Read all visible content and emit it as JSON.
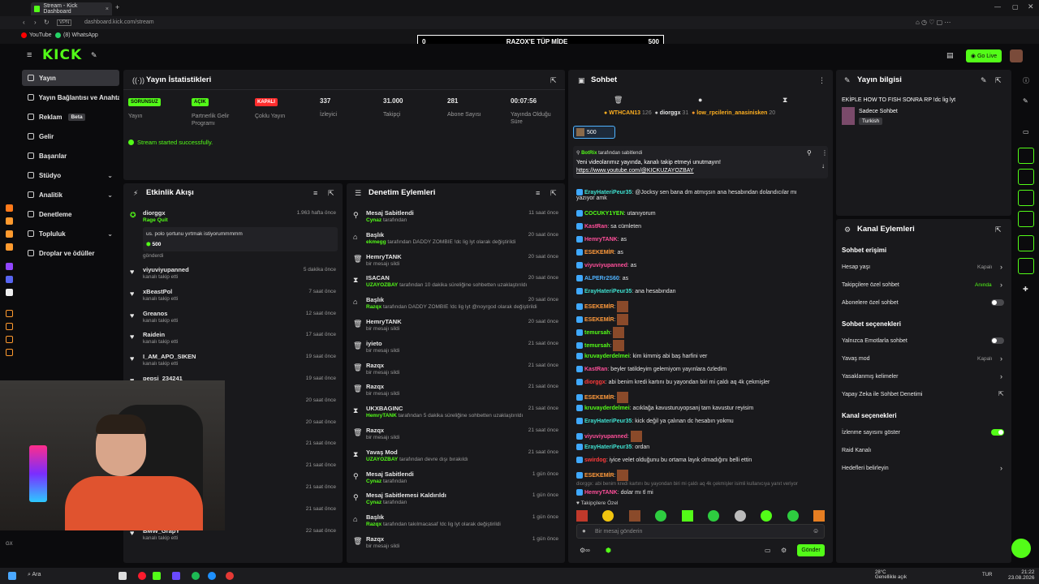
{
  "browser": {
    "tab_title": "Stream - Kick Dashboard",
    "url": "dashboard.kick.com/stream",
    "bookmarks": [
      "YouTube",
      "(8) WhatsApp"
    ]
  },
  "header": {
    "logo": "KICK",
    "goal_left": "0",
    "goal_title": "RAZQX'E TÜP MİDE",
    "goal_right": "500",
    "go_live": "Go Live"
  },
  "sidebar": {
    "items": [
      {
        "label": "Yayın"
      },
      {
        "label": "Yayın Bağlantısı ve Anahtarı"
      },
      {
        "label": "Reklam",
        "badge": "Beta"
      },
      {
        "label": "Gelir"
      },
      {
        "label": "Başarılar"
      },
      {
        "label": "Stüdyo"
      },
      {
        "label": "Analitik"
      },
      {
        "label": "Denetleme"
      },
      {
        "label": "Topluluk"
      },
      {
        "label": "Droplar ve ödüller"
      }
    ]
  },
  "stats": {
    "title": "Yayın İstatistikleri",
    "cells": [
      {
        "badge": "SORUNSUZ",
        "label": "Yayın"
      },
      {
        "badge": "AÇIK",
        "label": "Partnerlik Gelir Programı"
      },
      {
        "badge": "KAPALI",
        "label": "Çoklu Yayın"
      },
      {
        "value": "337",
        "label": "İzleyici"
      },
      {
        "value": "31.000",
        "label": "Takipçi"
      },
      {
        "value": "281",
        "label": "Abone Sayısı"
      },
      {
        "value": "00:07:56",
        "label": "Yayında Olduğu Süre"
      }
    ],
    "status_msg": "Stream started successfully."
  },
  "activity": {
    "title": "Etkinlik Akışı",
    "featured": {
      "name": "diorggx",
      "sub": "Rage Quit",
      "time": "1.963 hafta önce",
      "message": "us. polo şortunu yırtmak istiyorummmmm",
      "amount": "500",
      "footer": "gönderdi"
    },
    "items": [
      {
        "name": "viyuviyupanned",
        "sub": "kanalı takip etti",
        "time": "5 dakika önce"
      },
      {
        "name": "xBeastPol",
        "sub": "kanalı takip etti",
        "time": "7 saat önce"
      },
      {
        "name": "Greanos",
        "sub": "kanalı takip etti",
        "time": "12 saat önce"
      },
      {
        "name": "Raidein",
        "sub": "kanalı takip etti",
        "time": "17 saat önce"
      },
      {
        "name": "I_AM_APO_SIKEN",
        "sub": "kanalı takip etti",
        "time": "19 saat önce"
      },
      {
        "name": "pepsi_234241",
        "sub": "",
        "time": "19 saat önce"
      },
      {
        "name": "",
        "sub": "",
        "time": "20 saat önce"
      },
      {
        "name": "",
        "sub": "",
        "time": "20 saat önce"
      },
      {
        "name": "",
        "sub": "",
        "time": "21 saat önce"
      },
      {
        "name": "",
        "sub": "",
        "time": "21 saat önce"
      },
      {
        "name": "",
        "sub": "",
        "time": "21 saat önce"
      },
      {
        "name": "alexapp",
        "sub": "kanalı takip etti",
        "time": "21 saat önce"
      },
      {
        "name": "BMW_GrapY",
        "sub": "kanalı takip etti",
        "time": "22 saat önce"
      }
    ]
  },
  "moderation": {
    "title": "Denetim Eylemleri",
    "items": [
      {
        "name": "Mesaj Sabitlendi",
        "user": "Cynaz",
        "rest": "tarafından",
        "time": "11 saat önce"
      },
      {
        "name": "Başlık",
        "user": "ekmegg",
        "rest": "tarafından DADDY ZOMBIE !dc lig lyt olarak değiştirildi",
        "time": "20 saat önce"
      },
      {
        "name": "HemryTANK",
        "user": "",
        "rest": "bir mesajı sildi",
        "time": "20 saat önce"
      },
      {
        "name": "ISACAN",
        "user": "UZAYOZBAY",
        "rest": "tarafından 10 dakika süreliğine sohbetten uzaklaştırıldı",
        "time": "20 saat önce"
      },
      {
        "name": "Başlık",
        "user": "Razqx",
        "rest": "tarafından DADDY ZOMBIE !dc lig lyt @noyrgod olarak değiştirildi",
        "time": "20 saat önce"
      },
      {
        "name": "HemryTANK",
        "user": "",
        "rest": "bir mesajı sildi",
        "time": "20 saat önce"
      },
      {
        "name": "iyieto",
        "user": "",
        "rest": "bir mesajı sildi",
        "time": "21 saat önce"
      },
      {
        "name": "Razqx",
        "user": "",
        "rest": "bir mesajı sildi",
        "time": "21 saat önce"
      },
      {
        "name": "Razqx",
        "user": "",
        "rest": "bir mesajı sildi",
        "time": "21 saat önce"
      },
      {
        "name": "UKXBAGINC",
        "user": "HemryTANK",
        "rest": "tarafından 5 dakika süreliğine sohbetten uzaklaştırıldı",
        "time": "21 saat önce"
      },
      {
        "name": "Razqx",
        "user": "",
        "rest": "bir mesajı sildi",
        "time": "21 saat önce"
      },
      {
        "name": "Yavaş Mod",
        "user": "UZAYOZBAY",
        "rest": "tarafından devre dışı bırakıldı",
        "time": "21 saat önce"
      },
      {
        "name": "Mesaj Sabitlendi",
        "user": "Cynaz",
        "rest": "tarafından",
        "time": "1 gün önce"
      },
      {
        "name": "Mesaj Sabitlemesi Kaldırıldı",
        "user": "Cynaz",
        "rest": "tarafından",
        "time": "1 gün önce"
      },
      {
        "name": "Başlık",
        "user": "Razqx",
        "rest": "tarafından takılmacasaf !dc lig lyt olarak değiştirildi",
        "time": "1 gün önce"
      },
      {
        "name": "Razqx",
        "user": "",
        "rest": "bir mesajı sildi",
        "time": "1 gün önce"
      }
    ]
  },
  "chat": {
    "title": "Sohbet",
    "top_users": [
      {
        "name": "WTHCAN13",
        "count": "126"
      },
      {
        "name": "diorggx",
        "count": "31"
      },
      {
        "name": "low_rpcilerin_anasinisken",
        "count": "20"
      }
    ],
    "gift_count": "500",
    "pinned": {
      "by": "BotRix",
      "by_suffix": "tarafından sabitlendi",
      "text": "Yeni videolarımız yayında, kanalı takip etmeyi unutmayın!",
      "link": "https://www.youtube.com/@KICKUZAYOZBAY"
    },
    "messages": [
      {
        "user": "ErayHateriPeur35",
        "color": "u-cyan",
        "text": "@Jocksy sen bana dm atmışsın ana hesabından dolandıcılar mı"
      },
      {
        "user": "",
        "color": "",
        "text": "yazıyor amk"
      },
      {
        "user": "COCUKY1YEN",
        "color": "u-green",
        "text": "utanıyorum"
      },
      {
        "user": "KastRan",
        "color": "u-pink",
        "text": "sa cümleten"
      },
      {
        "user": "HemryTANK",
        "color": "u-pink",
        "text": "as"
      },
      {
        "user": "ESEKEMİR",
        "color": "u-orange",
        "text": "as"
      },
      {
        "user": "viyuviyupanned",
        "color": "u-pink",
        "text": "as"
      },
      {
        "user": "ALPERr2S60",
        "color": "u-blue",
        "text": "as"
      },
      {
        "user": "ErayHateriPeur35",
        "color": "u-cyan",
        "text": "ana hesabından"
      },
      {
        "user": "ESEKEMİR",
        "color": "u-orange",
        "text": ""
      },
      {
        "user": "ESEKEMİR",
        "color": "u-orange",
        "text": ""
      },
      {
        "user": "temursah",
        "color": "u-green",
        "text": ""
      },
      {
        "user": "temursah",
        "color": "u-green",
        "text": ""
      },
      {
        "user": "kruvayderdelmei",
        "color": "u-green",
        "text": "kim kimmiş abi baş harfini ver"
      },
      {
        "user": "KastRan",
        "color": "u-pink",
        "text": "beyler tatildeyim gelemiyom yayınlara özledim"
      },
      {
        "user": "diorggx",
        "color": "u-red",
        "text": "abi benim kredi kartını bu yayondan biri mi çaldı aq 4k çekmişler"
      },
      {
        "user": "ESEKEMİR",
        "color": "u-orange",
        "text": ""
      },
      {
        "user": "kruvayderdelmei",
        "color": "u-green",
        "text": "acıklağa kavusturuyopsanj tam kavustur reyisim"
      },
      {
        "user": "ErayHateriPeur35",
        "color": "u-cyan",
        "text": "kick değil ya çalınan dc hesabın yokmu"
      },
      {
        "user": "viyuviyupanned",
        "color": "u-pink",
        "text": ""
      },
      {
        "user": "ErayHateriPeur35",
        "color": "u-cyan",
        "text": "ordan"
      },
      {
        "user": "swirdog",
        "color": "u-red",
        "text": "iyice velet olduğunu bu ortama layık olmadığını belli ettin"
      },
      {
        "user": "ESEKEMİR",
        "color": "u-orange",
        "text": ""
      },
      {
        "user": "",
        "color": "",
        "text": "diorggx: abi benim kredi kartını bu yayondan biri mi çaldı aq 4k çekmişler isimli kullanıcıya yanıt veriyor"
      },
      {
        "user": "HemryTANK",
        "color": "u-pink",
        "text": "dolar mı tl mi"
      }
    ],
    "followers_only": "Takipçilere Özel",
    "input_placeholder": "Bir mesaj gönderin",
    "send": "Gönder"
  },
  "stream_info": {
    "title": "Yayın bilgisi",
    "stream_title": "EKİPLE HOW TO FISH SONRA RP !dc lig lyt",
    "category": "Sadece Sohbet",
    "language": "Turkish"
  },
  "channel_actions": {
    "title": "Kanal Eylemleri",
    "sections": [
      {
        "head": "Sohbet erişimi",
        "rows": [
          {
            "label": "Hesap yaşı",
            "value": "Kapalı"
          },
          {
            "label": "Takipçilere özel sohbet",
            "value": "Anında"
          },
          {
            "label": "Abonelere özel sohbet",
            "value": ""
          }
        ]
      },
      {
        "head": "Sohbet seçenekleri",
        "rows": [
          {
            "label": "Yalnızca Emotlarla sohbet",
            "value": ""
          },
          {
            "label": "Yavaş mod",
            "value": "Kapalı"
          },
          {
            "label": "Yasaklanmış kelimeler",
            "value": ""
          },
          {
            "label": "Yapay Zeka ile Sohbet Denetimi",
            "value": ""
          }
        ]
      },
      {
        "head": "Kanal seçenekleri",
        "rows": [
          {
            "label": "İzlenme sayısını göster",
            "value": ""
          },
          {
            "label": "Raid Kanalı",
            "value": ""
          },
          {
            "label": "Hedefleri belirleyin",
            "value": ""
          }
        ]
      }
    ]
  },
  "taskbar": {
    "search": "Ara",
    "weather_temp": "28°C",
    "weather_desc": "Genellikle açık",
    "lang": "TUR",
    "time": "21:22",
    "date": "23.08.2026"
  },
  "colors": {
    "accent": "#53fc18",
    "panel": "#19191c",
    "bg": "#0b0b0d"
  }
}
